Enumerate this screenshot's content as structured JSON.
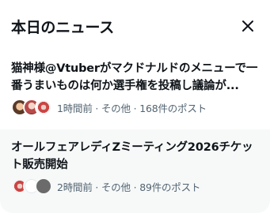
{
  "header": {
    "title": "本日のニュース"
  },
  "news": [
    {
      "title": "猫神様@Vtuberがマクドナルドのメニューで一番うまいものは何か選手権を投稿し議論が...",
      "meta": "1時間前 · その他 · 168件のポスト"
    },
    {
      "title": "オールフェアレディZミーティング2026チケット販売開始",
      "meta": "2時間前 · その他 · 89件のポスト"
    }
  ],
  "icons": {
    "close": "close-icon"
  }
}
